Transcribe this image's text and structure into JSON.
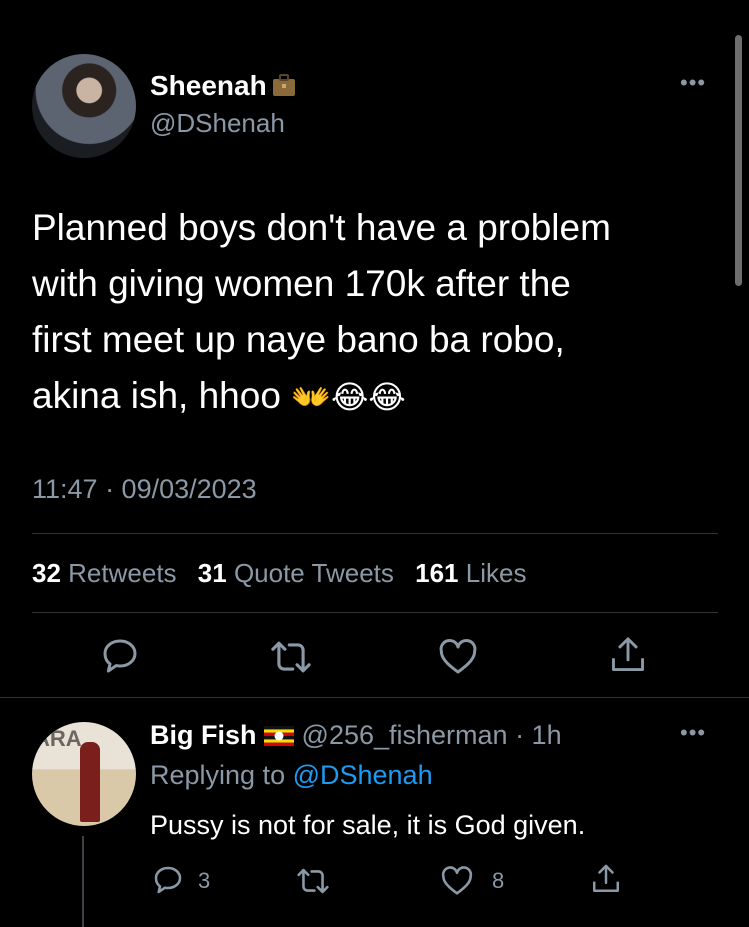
{
  "tweet": {
    "author_name": "Sheenah",
    "author_handle": "@DShenah",
    "text_line1": "Planned boys don't have a problem",
    "text_line2": "with giving women 170k after the",
    "text_line3": "first meet up naye bano ba robo,",
    "text_line4": "akina ish, hhoo",
    "emojis": "👐😂😂",
    "timestamp": "11:47 · 09/03/2023",
    "retweets_count": "32",
    "retweets_label": "Retweets",
    "quotes_count": "31",
    "quotes_label": "Quote Tweets",
    "likes_count": "161",
    "likes_label": "Likes",
    "more": "•••"
  },
  "reply": {
    "author_name": "Big Fish",
    "author_handle": "@256_fisherman",
    "time": " · 1h",
    "replying_prefix": "Replying to ",
    "replying_mention": "@DShenah",
    "text": "Pussy is not for sale, it is God given.",
    "reply_count": "3",
    "like_count": "8",
    "avatar_letters": "ARA",
    "more": "•••"
  },
  "icons": {
    "reply": "reply-icon",
    "retweet": "retweet-icon",
    "like": "heart-icon",
    "share": "share-icon",
    "badge": "briefcase-icon",
    "flag": "uganda-flag-icon"
  },
  "colors": {
    "background": "#000000",
    "text": "#e7e9ea",
    "secondary": "#8b98a5",
    "link": "#1d9bf0"
  }
}
